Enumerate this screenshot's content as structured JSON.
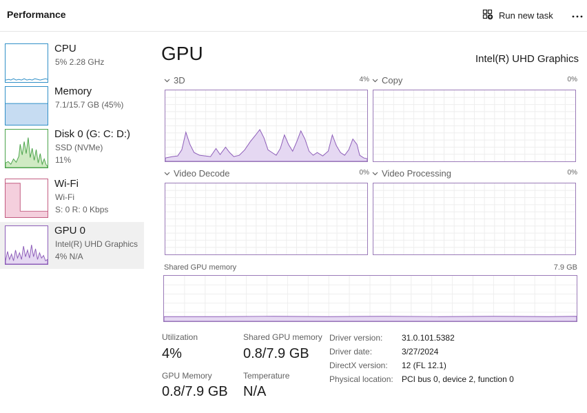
{
  "header": {
    "title": "Performance",
    "run_new_task": "Run new task"
  },
  "sidebar": {
    "items": [
      {
        "name": "CPU",
        "line1": "5%  2.28 GHz",
        "line2": "",
        "color": "#2f8fc7"
      },
      {
        "name": "Memory",
        "line1": "7.1/15.7 GB (45%)",
        "line2": "",
        "color": "#2f8fc7"
      },
      {
        "name": "Disk 0 (G: C: D:)",
        "line1": "SSD (NVMe)",
        "line2": "11%",
        "color": "#4aa34a"
      },
      {
        "name": "Wi-Fi",
        "line1": "Wi-Fi",
        "line2": "S: 0  R: 0 Kbps",
        "color": "#c25b80"
      },
      {
        "name": "GPU 0",
        "line1": "Intel(R) UHD Graphics",
        "line2": "4%  N/A",
        "color": "#8c5cb8"
      }
    ]
  },
  "gpu": {
    "title": "GPU",
    "model": "Intel(R) UHD Graphics",
    "engines": [
      {
        "label": "3D",
        "percent": "4%"
      },
      {
        "label": "Copy",
        "percent": "0%"
      },
      {
        "label": "Video Decode",
        "percent": "0%"
      },
      {
        "label": "Video Processing",
        "percent": "0%"
      }
    ],
    "shared_memory_label": "Shared GPU memory",
    "shared_memory_max": "7.9 GB",
    "accent_color": "#8c5cb8",
    "fill_color": "#e5d8f2"
  },
  "stats": {
    "utilization_label": "Utilization",
    "utilization_value": "4%",
    "shared_gpu_memory_label": "Shared GPU memory",
    "shared_gpu_memory_value": "0.8/7.9 GB",
    "gpu_memory_label": "GPU Memory",
    "gpu_memory_value": "0.8/7.9 GB",
    "temperature_label": "Temperature",
    "temperature_value": "N/A"
  },
  "details": {
    "driver_version_label": "Driver version:",
    "driver_version": "31.0.101.5382",
    "driver_date_label": "Driver date:",
    "driver_date": "3/27/2024",
    "directx_label": "DirectX version:",
    "directx": "12 (FL 12.1)",
    "physical_location_label": "Physical location:",
    "physical_location": "PCI bus 0, device 2, function 0"
  }
}
